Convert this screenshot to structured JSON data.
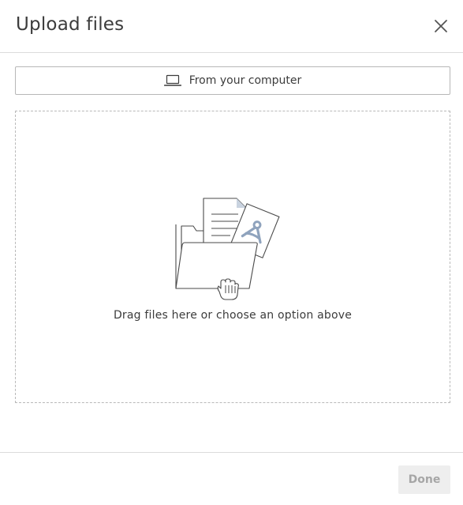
{
  "dialog": {
    "title": "Upload files",
    "close_icon": "close-icon"
  },
  "source": {
    "computer_label": "From your computer",
    "computer_icon": "laptop-icon"
  },
  "dropzone": {
    "text": "Drag files here or choose an option above",
    "illustration_icon": "folder-documents-illustration"
  },
  "footer": {
    "done_label": "Done",
    "done_disabled": true
  },
  "colors": {
    "text": "#3c3c3c",
    "border": "#dcdcdc",
    "disabled_bg": "#eeeeee",
    "disabled_text": "#a6a6a6",
    "illustration_accent": "#8fa3bd"
  }
}
